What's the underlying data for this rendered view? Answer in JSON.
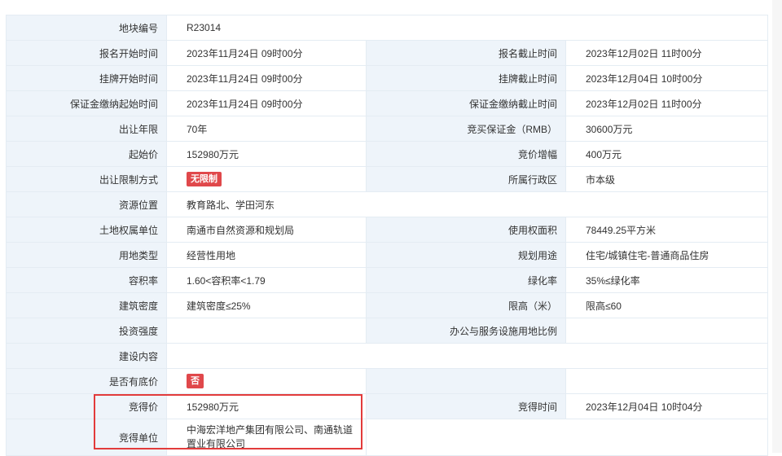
{
  "rows": [
    {
      "l1": "地块编号",
      "v1": "R23014"
    },
    {
      "l1": "报名开始时间",
      "v1": "2023年11月24日 09时00分",
      "l2": "报名截止时间",
      "v2": "2023年12月02日 11时00分"
    },
    {
      "l1": "挂牌开始时间",
      "v1": "2023年11月24日 09时00分",
      "l2": "挂牌截止时间",
      "v2": "2023年12月04日 10时00分"
    },
    {
      "l1": "保证金缴纳起始时间",
      "v1": "2023年11月24日 09时00分",
      "l2": "保证金缴纳截止时间",
      "v2": "2023年12月02日 11时00分"
    },
    {
      "l1": "出让年限",
      "v1": "70年",
      "l2": "竞买保证金（RMB）",
      "v2": "30600万元"
    },
    {
      "l1": "起始价",
      "v1": "152980万元",
      "l2": "竞价增幅",
      "v2": "400万元"
    },
    {
      "l1": "出让限制方式",
      "v1": "无限制",
      "l2": "所属行政区",
      "v2": "市本级"
    },
    {
      "l1": "资源位置",
      "v1": "教育路北、学田河东"
    },
    {
      "l1": "土地权属单位",
      "v1": "南通市自然资源和规划局",
      "l2": "使用权面积",
      "v2": "78449.25平方米"
    },
    {
      "l1": "用地类型",
      "v1": "经营性用地",
      "l2": "规划用途",
      "v2": "住宅/城镇住宅-普通商品住房"
    },
    {
      "l1": "容积率",
      "v1": "1.60<容积率<1.79",
      "l2": "绿化率",
      "v2": "35%≤绿化率"
    },
    {
      "l1": "建筑密度",
      "v1": "建筑密度≤25%",
      "l2": "限高（米）",
      "v2": "限高≤60"
    },
    {
      "l1": "投资强度",
      "v1": "",
      "l2": "办公与服务设施用地比例",
      "v2": ""
    },
    {
      "l1": "建设内容",
      "v1": ""
    },
    {
      "l1": "是否有底价",
      "v1": "否"
    },
    {
      "l1": "竞得价",
      "v1": "152980万元",
      "l2": "竞得时间",
      "v2": "2023年12月04日 10时04分"
    },
    {
      "l1": "竞得单位",
      "v1_line1": "中海宏洋地产集团有限公司、南通轨道",
      "v1_line2": "置业有限公司"
    }
  ],
  "colors": {
    "label_bg": "#eef4fa",
    "border": "#e4ecf3",
    "badge": "#e0484b",
    "highlight": "#e23b3b"
  }
}
